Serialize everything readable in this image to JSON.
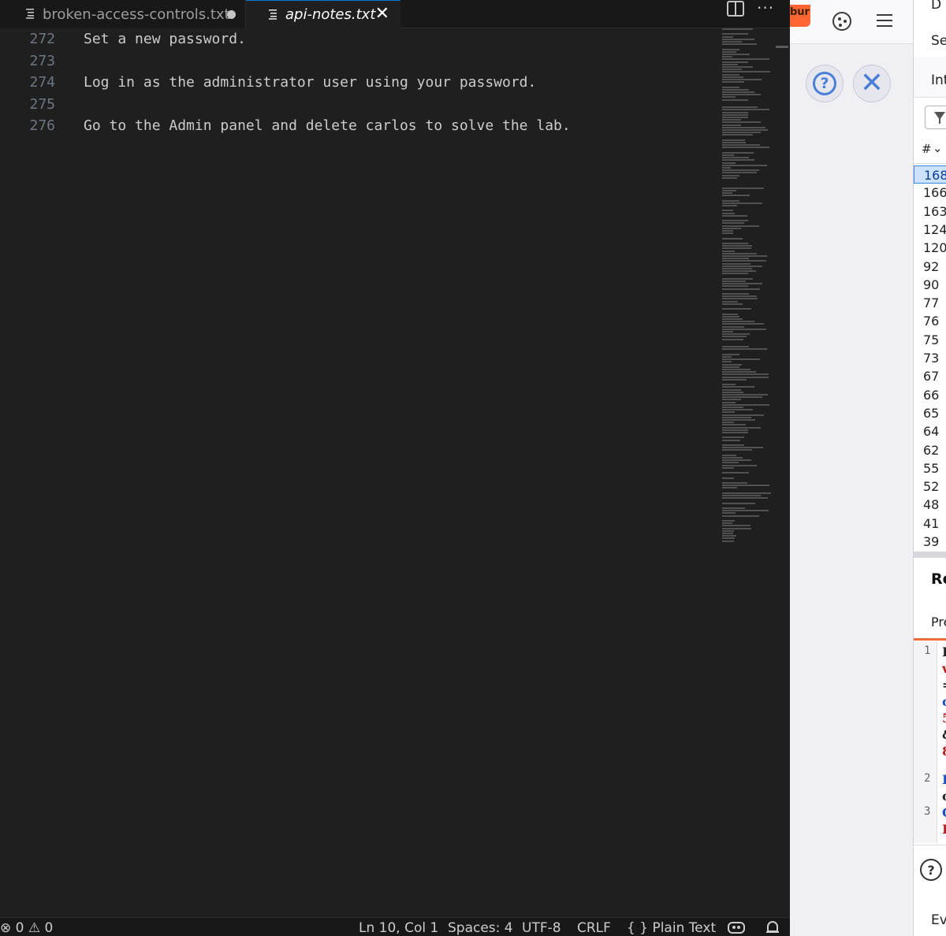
{
  "tabs": [
    {
      "label": "broken-access-controls.txt",
      "dirty": true
    },
    {
      "label": "api-notes.txt",
      "active": true
    }
  ],
  "editor": {
    "lines": [
      {
        "number": "272",
        "text": "Set a new password."
      },
      {
        "number": "273",
        "text": ""
      },
      {
        "number": "274",
        "text": "Log in as the administrator user using your password."
      },
      {
        "number": "275",
        "text": ""
      },
      {
        "number": "276",
        "text": "Go to the Admin panel and delete carlos to solve the lab."
      }
    ]
  },
  "status": {
    "errors": "0",
    "warnings": "0",
    "position": "Ln 10, Col 1",
    "spaces": "Spaces: 4",
    "encoding": "UTF-8",
    "eol": "CRLF",
    "language_icon": "{ }",
    "language": "Plain Text"
  },
  "browser": {
    "burp_tab_label": "bur",
    "help_glyph": "?",
    "close_glyph": "✕"
  },
  "devpanel": {
    "top_label": "D",
    "search_label": "Sea",
    "int_label": "Int",
    "hash_header": "#",
    "request_ids": [
      "168",
      "166",
      "163",
      "124",
      "120",
      "92",
      "90",
      "77",
      "76",
      "75",
      "73",
      "67",
      "66",
      "65",
      "64",
      "62",
      "55",
      "52",
      "48",
      "41",
      "39"
    ],
    "selected_index": 0,
    "request_label": "Re",
    "pretty_tab": "Pre",
    "code_lines": [
      {
        "num": "1",
        "chars": [
          {
            "c": "I",
            "color": "#222"
          },
          {
            "c": "v",
            "color": "#b22222"
          },
          {
            "c": "=",
            "color": "#222"
          },
          {
            "c": "c",
            "color": "#1f4fbf"
          },
          {
            "c": "5",
            "color": "#b22222"
          },
          {
            "c": "&",
            "color": "#222"
          },
          {
            "c": "8",
            "color": "#b22222"
          }
        ]
      },
      {
        "num": "2",
        "chars": [
          {
            "c": "I",
            "color": "#1f4fbf"
          },
          {
            "c": "c",
            "color": "#222"
          }
        ]
      },
      {
        "num": "3",
        "chars": [
          {
            "c": "C",
            "color": "#1f4fbf"
          },
          {
            "c": "I",
            "color": "#b22222"
          }
        ]
      }
    ],
    "help_glyph": "?",
    "events_label": "Eve"
  }
}
